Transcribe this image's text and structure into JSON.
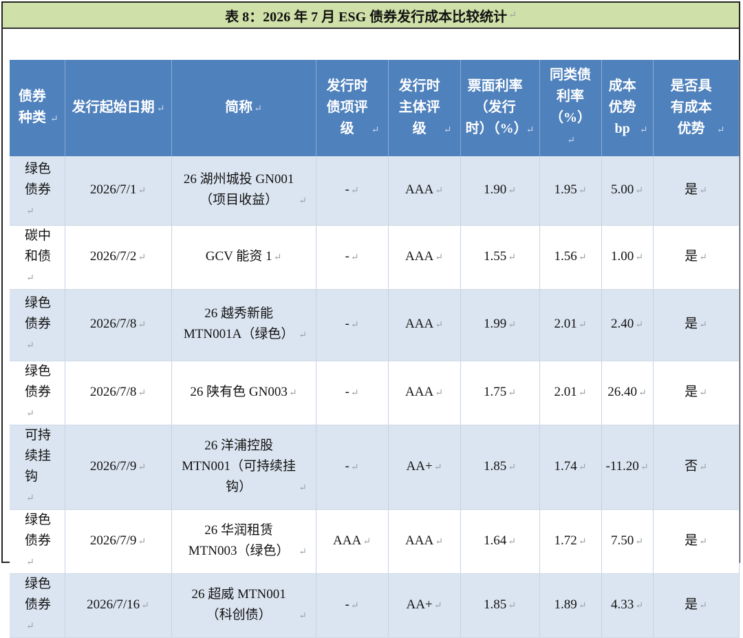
{
  "title": "表 8：2026 年 7 月 ESG 债券发行成本比较统计",
  "mark": "↵",
  "headers": [
    "债券种类",
    "发行起始日期",
    "简称",
    "发行时债项评级",
    "发行时主体评级",
    "票面利率（发行时）（%）",
    "同类债利率（%）",
    "成本优势bp",
    "是否具有成本优势"
  ],
  "rows": [
    {
      "kind": "绿色债券",
      "date": "2026/7/1",
      "name": "26 湖州城投 GN001（项目收益）",
      "bond_rating": "-",
      "issuer_rating": "AAA",
      "coupon": "1.90",
      "peer": "1.95",
      "bp": "5.00",
      "adv": "是"
    },
    {
      "kind": "碳中和债",
      "date": "2026/7/2",
      "name": "GCV 能资 1",
      "bond_rating": "-",
      "issuer_rating": "AAA",
      "coupon": "1.55",
      "peer": "1.56",
      "bp": "1.00",
      "adv": "是"
    },
    {
      "kind": "绿色债券",
      "date": "2026/7/8",
      "name": "26 越秀新能 MTN001A（绿色）",
      "bond_rating": "-",
      "issuer_rating": "AAA",
      "coupon": "1.99",
      "peer": "2.01",
      "bp": "2.40",
      "adv": "是"
    },
    {
      "kind": "绿色债券",
      "date": "2026/7/8",
      "name": "26 陕有色 GN003",
      "bond_rating": "-",
      "issuer_rating": "AAA",
      "coupon": "1.75",
      "peer": "2.01",
      "bp": "26.40",
      "adv": "是"
    },
    {
      "kind": "可持续挂钩",
      "date": "2026/7/9",
      "name": "26 洋浦控股 MTN001（可持续挂钩）",
      "bond_rating": "-",
      "issuer_rating": "AA+",
      "coupon": "1.85",
      "peer": "1.74",
      "bp": "-11.20",
      "adv": "否"
    },
    {
      "kind": "绿色债券",
      "date": "2026/7/9",
      "name": "26 华润租赁 MTN003（绿色）",
      "bond_rating": "AAA",
      "issuer_rating": "AAA",
      "coupon": "1.64",
      "peer": "1.72",
      "bp": "7.50",
      "adv": "是"
    },
    {
      "kind": "绿色债券",
      "date": "2026/7/16",
      "name": "26 超威 MTN001（科创债）",
      "bond_rating": "-",
      "issuer_rating": "AA+",
      "coupon": "1.85",
      "peer": "1.89",
      "bp": "4.33",
      "adv": "是"
    }
  ]
}
